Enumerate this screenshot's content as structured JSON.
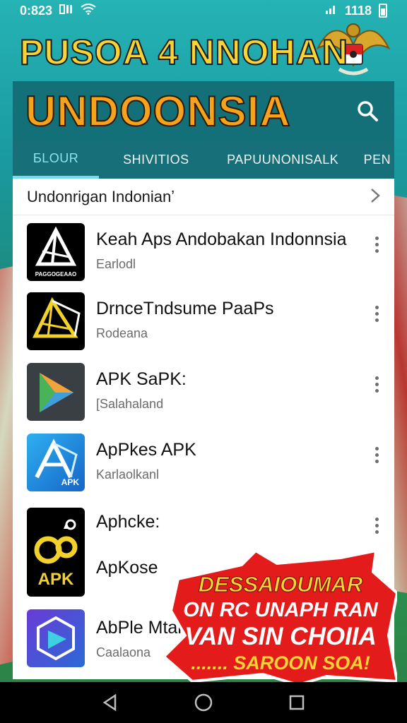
{
  "status_bar": {
    "time": "0:823",
    "right_text": "1118"
  },
  "headline": "PUSOA 4 NNOHAN",
  "app_bar": {
    "title": "UNDOONSIA"
  },
  "tabs": [
    {
      "label": "ƂLOUR",
      "active": true
    },
    {
      "label": "SHIVITIOS",
      "active": false
    },
    {
      "label": "PAPUUNONISALK",
      "active": false
    },
    {
      "label": "PEN",
      "active": false
    }
  ],
  "breadcrumb": {
    "label": "Undonrigan Indonianʼ"
  },
  "apps": [
    {
      "title": "Keah Aps Andobakan Indonnsia",
      "subtitle": "Earlodl",
      "icon": "black-pyramid-icon",
      "icon_caption": "PAGGOGEAAO"
    },
    {
      "title": "DrnceTndsume PaaPs",
      "subtitle": "Rodeana",
      "icon": "yellow-pyramid-icon",
      "icon_caption": ""
    },
    {
      "title": "APK SaPK:",
      "subtitle": "[Salahaland",
      "icon": "play-triangle-icon",
      "icon_caption": ""
    },
    {
      "title": "ApPkes APK",
      "subtitle": "Karlaolkanl",
      "icon": "blue-a-icon",
      "icon_caption": "APK"
    },
    {
      "title": "Aphcke:",
      "subtitle": "ApKose",
      "icon": "apk-yellow-icon",
      "icon_caption": "APK"
    },
    {
      "title": "AbPle Mtak",
      "subtitle": "Caalaona",
      "icon": "purple-cube-icon",
      "icon_caption": ""
    }
  ],
  "promo": {
    "line1": "DESSAIOUMAR",
    "line2": "ON RC UNAPH RAN",
    "line3": "VAN SIN CHOIIA",
    "line4": "....... SAROON SOA!"
  },
  "colors": {
    "app_bar": "#136f78",
    "tab_active": "#8fe4ee",
    "headline_yellow": "#f6d437",
    "title_orange": "#f6a21c",
    "promo_red": "#e31b1b"
  }
}
